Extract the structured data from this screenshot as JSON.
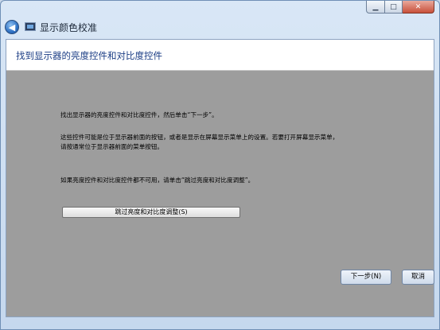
{
  "window": {
    "caption_buttons": {
      "minimize": "▁",
      "maximize": "□",
      "close": "✕"
    }
  },
  "titlebar": {
    "back_glyph": "◀",
    "app_title": "显示颜色校准"
  },
  "page": {
    "heading": "找到显示器的亮度控件和对比度控件",
    "paragraphs": [
      "找出显示器的亮度控件和对比度控件，然后单击“下一步”。",
      "这些控件可能是位于显示器前面的按钮，或者是显示在屏幕显示菜单上的设置。若要打开屏幕显示菜单，",
      "请按通常位于显示器前面的菜单按钮。",
      "如果亮度控件和对比度控件都不可用，请单击“跳过亮度和对比度调整”。"
    ],
    "skip_button_label": "跳过亮度和对比度调整(S)"
  },
  "footer": {
    "next_label": "下一步(N)",
    "cancel_label": "取消"
  },
  "icons": [
    "back-arrow-icon",
    "display-monitor-icon"
  ],
  "colors": {
    "heading": "#1a3c84",
    "content_background": "#9d9d9d",
    "window_frame": "#c9d8ea"
  }
}
